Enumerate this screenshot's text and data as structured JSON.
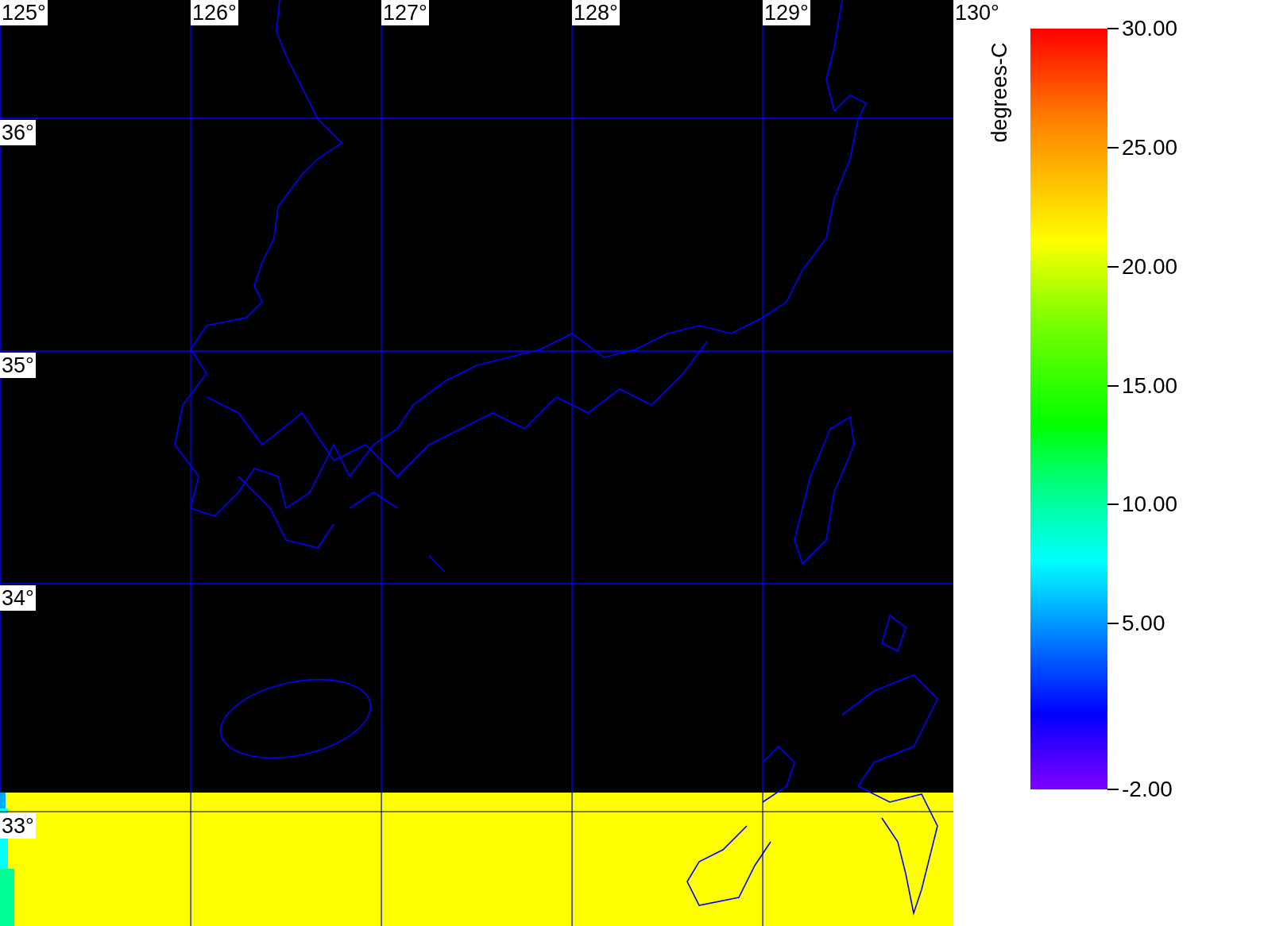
{
  "map": {
    "longitude_labels": [
      "125°",
      "126°",
      "127°",
      "128°",
      "129°",
      "130°"
    ],
    "latitude_labels": [
      "36°",
      "35°",
      "34°",
      "33°"
    ]
  },
  "colorbar": {
    "unit": "degrees-C",
    "ticks": [
      "30.00",
      "25.00",
      "20.00",
      "15.00",
      "10.00",
      "5.00",
      "-2.00"
    ]
  }
}
